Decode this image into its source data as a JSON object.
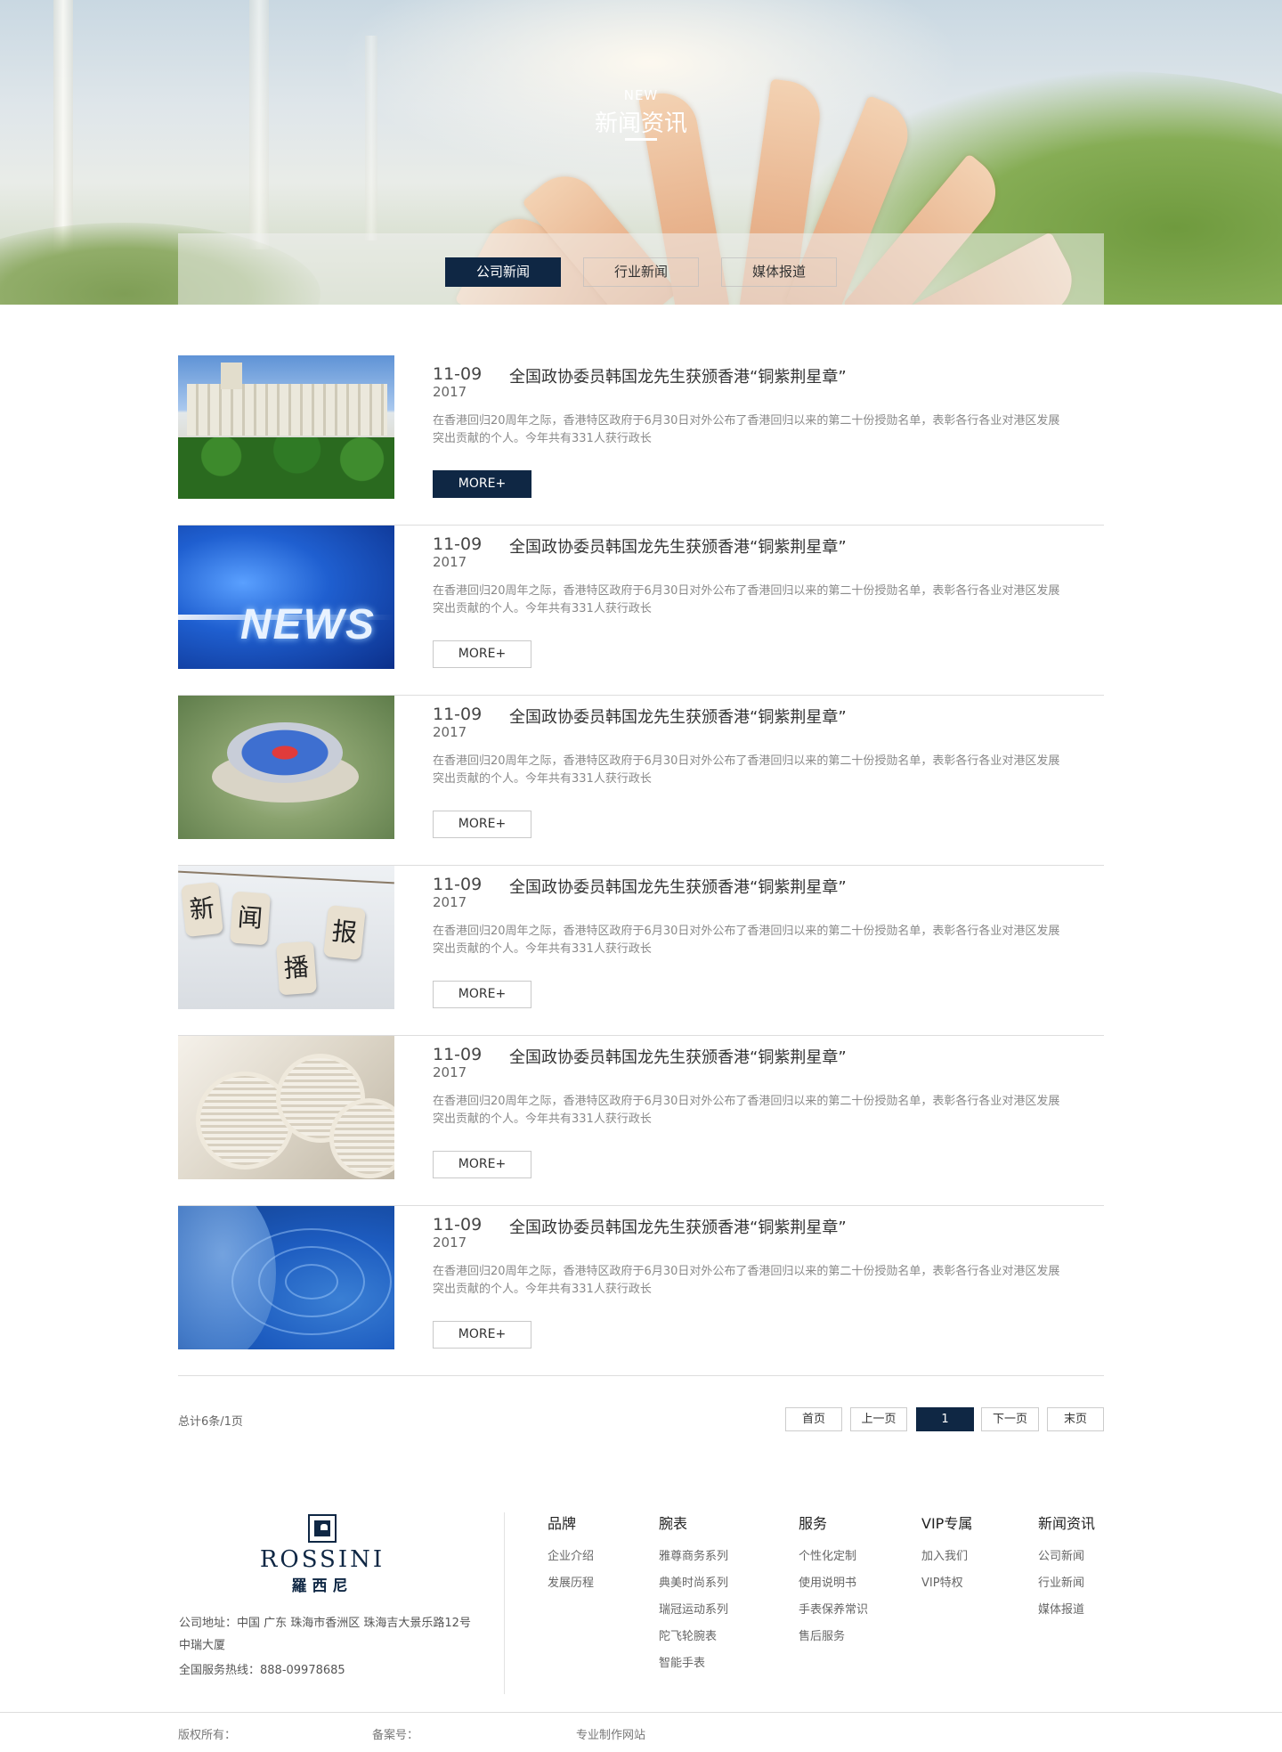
{
  "banner": {
    "title_en": "NEW",
    "title_cn": "新闻资讯"
  },
  "tabs": [
    {
      "label": "公司新闻",
      "active": true
    },
    {
      "label": "行业新闻",
      "active": false
    },
    {
      "label": "媒体报道",
      "active": false
    }
  ],
  "news": [
    {
      "date": "11-09",
      "year": "2017",
      "title": "全国政协委员韩国龙先生获颁香港“铜紫荆星章”",
      "summary": "在香港回归20周年之际，香港特区政府于6月30日对外公布了香港回归以来的第二十份授勋名单，表彰各行各业对港区发展突出贡献的个人。今年共有331人获行政长",
      "more": "MORE+",
      "image": "building-photo"
    },
    {
      "date": "11-09",
      "year": "2017",
      "title": "全国政协委员韩国龙先生获颁香港“铜紫荆星章”",
      "summary": "在香港回归20周年之际，香港特区政府于6月30日对外公布了香港回归以来的第二十份授勋名单，表彰各行各业对港区发展突出贡献的个人。今年共有331人获行政长",
      "more": "MORE+",
      "image": "news-graphic",
      "image_text": "NEWS"
    },
    {
      "date": "11-09",
      "year": "2017",
      "title": "全国政协委员韩国龙先生获颁香港“铜紫荆星章”",
      "summary": "在香港回归20周年之际，香港特区政府于6月30日对外公布了香港回归以来的第二十份授勋名单，表彰各行各业对港区发展突出贡献的个人。今年共有331人获行政长",
      "more": "MORE+",
      "image": "stadium-aerial"
    },
    {
      "date": "11-09",
      "year": "2017",
      "title": "全国政协委员韩国龙先生获颁香港“铜紫荆星章”",
      "summary": "在香港回归20周年之际，香港特区政府于6月30日对外公布了香港回归以来的第二十份授勋名单，表彰各行各业对港区发展突出贡献的个人。今年共有331人获行政长",
      "more": "MORE+",
      "image": "hanging-tags",
      "image_chars": [
        "新",
        "闻",
        "播",
        "报"
      ]
    },
    {
      "date": "11-09",
      "year": "2017",
      "title": "全国政协委员韩国龙先生获颁香港“铜紫荆星章”",
      "summary": "在香港回归20周年之际，香港特区政府于6月30日对外公布了香港回归以来的第二十份授勋名单，表彰各行各业对港区发展突出贡献的个人。今年共有331人获行政长",
      "more": "MORE+",
      "image": "newspapers"
    },
    {
      "date": "11-09",
      "year": "2017",
      "title": "全国政协委员韩国龙先生获颁香港“铜紫荆星章”",
      "summary": "在香港回归20周年之际，香港特区政府于6月30日对外公布了香港回归以来的第二十份授勋名单，表彰各行各业对港区发展突出贡献的个人。今年共有331人获行政长",
      "more": "MORE+",
      "image": "blue-globe"
    }
  ],
  "pagination": {
    "total": "总计6条/1页",
    "first": "首页",
    "prev": "上一页",
    "current": "1",
    "next": "下一页",
    "last": "末页"
  },
  "footer": {
    "logo_en": "ROSSINI",
    "logo_cn": "羅西尼",
    "address": "公司地址：中国 广东 珠海市香洲区 珠海吉大景乐路12号中瑞大厦",
    "phone": "全国服务热线：888-09978685",
    "columns": [
      {
        "head": "品牌",
        "links": [
          "企业介绍",
          "发展历程"
        ]
      },
      {
        "head": "腕表",
        "links": [
          "雅尊商务系列",
          "典美时尚系列",
          "瑞冠运动系列",
          "陀飞轮腕表",
          "智能手表"
        ]
      },
      {
        "head": "服务",
        "links": [
          "个性化定制",
          "使用说明书",
          "手表保养常识",
          "售后服务"
        ]
      },
      {
        "head": "VIP专属",
        "links": [
          "加入我们",
          "VIP特权"
        ]
      },
      {
        "head": "新闻资讯",
        "links": [
          "公司新闻",
          "行业新闻",
          "媒体报道"
        ]
      }
    ],
    "copyright": "版权所有：",
    "icp": "备案号：",
    "made_by": "专业制作网站"
  },
  "colors": {
    "accent": "#0f2744",
    "summary_text": "#8a8a8a"
  }
}
